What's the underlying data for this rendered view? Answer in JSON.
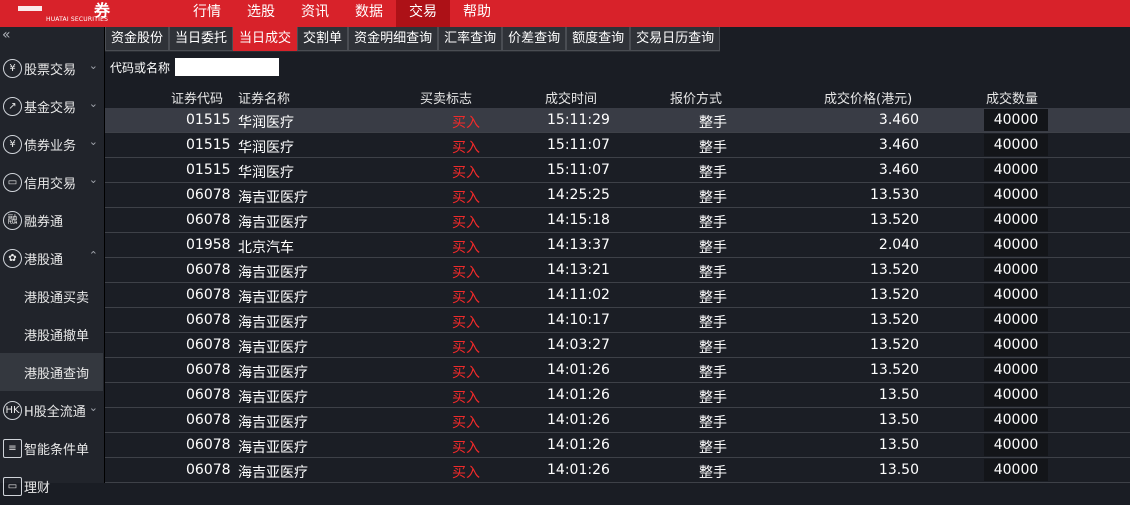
{
  "app": {
    "logo_char": "券",
    "logo_sub": "HUATAI SECURITIES"
  },
  "menu": [
    "行情",
    "选股",
    "资讯",
    "数据",
    "交易",
    "帮助"
  ],
  "menu_active": "交易",
  "sidebar": {
    "collapse_glyph": "«",
    "items": [
      {
        "icon": "¥",
        "label": "股票交易",
        "chev": "⌄"
      },
      {
        "icon": "↗",
        "label": "基金交易",
        "chev": "⌄"
      },
      {
        "icon": "¥",
        "label": "债券业务",
        "chev": "⌄"
      },
      {
        "icon": "▭",
        "label": "信用交易",
        "chev": "⌄"
      },
      {
        "icon": "融",
        "label": "融券通",
        "chev": ""
      },
      {
        "icon": "✿",
        "label": "港股通",
        "chev": "⌃"
      }
    ],
    "sub_items": [
      "港股通买卖",
      "港股通撤单",
      "港股通查询"
    ],
    "active_sub": "港股通查询",
    "bottom_items": [
      {
        "icon": "HK",
        "label": "H股全流通",
        "chev": "⌄"
      },
      {
        "icon": "≡",
        "label": "智能条件单",
        "chev": ""
      },
      {
        "icon": "▭",
        "label": "理财",
        "chev": ""
      }
    ]
  },
  "tabs": [
    "资金股份",
    "当日委托",
    "当日成交",
    "交割单",
    "资金明细查询",
    "汇率查询",
    "价差查询",
    "额度查询",
    "交易日历查询"
  ],
  "active_tab": "当日成交",
  "search": {
    "label": "代码或名称",
    "value": ""
  },
  "columns": [
    "证券代码",
    "证券名称",
    "买卖标志",
    "成交时间",
    "报价方式",
    "成交价格(港元)",
    "成交数量"
  ],
  "rows": [
    {
      "code": "01515",
      "name": "华润医疗",
      "side": "买入",
      "time": "15:11:29",
      "method": "整手",
      "price": "3.460",
      "qty": "40000"
    },
    {
      "code": "01515",
      "name": "华润医疗",
      "side": "买入",
      "time": "15:11:07",
      "method": "整手",
      "price": "3.460",
      "qty": "40000"
    },
    {
      "code": "01515",
      "name": "华润医疗",
      "side": "买入",
      "time": "15:11:07",
      "method": "整手",
      "price": "3.460",
      "qty": "40000"
    },
    {
      "code": "06078",
      "name": "海吉亚医疗",
      "side": "买入",
      "time": "14:25:25",
      "method": "整手",
      "price": "13.530",
      "qty": "40000"
    },
    {
      "code": "06078",
      "name": "海吉亚医疗",
      "side": "买入",
      "time": "14:15:18",
      "method": "整手",
      "price": "13.520",
      "qty": "40000"
    },
    {
      "code": "01958",
      "name": "北京汽车",
      "side": "买入",
      "time": "14:13:37",
      "method": "整手",
      "price": "2.040",
      "qty": "40000"
    },
    {
      "code": "06078",
      "name": "海吉亚医疗",
      "side": "买入",
      "time": "14:13:21",
      "method": "整手",
      "price": "13.520",
      "qty": "40000"
    },
    {
      "code": "06078",
      "name": "海吉亚医疗",
      "side": "买入",
      "time": "14:11:02",
      "method": "整手",
      "price": "13.520",
      "qty": "40000"
    },
    {
      "code": "06078",
      "name": "海吉亚医疗",
      "side": "买入",
      "time": "14:10:17",
      "method": "整手",
      "price": "13.520",
      "qty": "40000"
    },
    {
      "code": "06078",
      "name": "海吉亚医疗",
      "side": "买入",
      "time": "14:03:27",
      "method": "整手",
      "price": "13.520",
      "qty": "40000"
    },
    {
      "code": "06078",
      "name": "海吉亚医疗",
      "side": "买入",
      "time": "14:01:26",
      "method": "整手",
      "price": "13.520",
      "qty": "40000"
    },
    {
      "code": "06078",
      "name": "海吉亚医疗",
      "side": "买入",
      "time": "14:01:26",
      "method": "整手",
      "price": "13.50",
      "qty": "40000"
    },
    {
      "code": "06078",
      "name": "海吉亚医疗",
      "side": "买入",
      "time": "14:01:26",
      "method": "整手",
      "price": "13.50",
      "qty": "40000"
    },
    {
      "code": "06078",
      "name": "海吉亚医疗",
      "side": "买入",
      "time": "14:01:26",
      "method": "整手",
      "price": "13.50",
      "qty": "40000"
    },
    {
      "code": "06078",
      "name": "海吉亚医疗",
      "side": "买入",
      "time": "14:01:26",
      "method": "整手",
      "price": "13.50",
      "qty": "40000"
    }
  ],
  "colors": {
    "brand": "#d8222a",
    "buy": "#f22a2a",
    "bg": "#1a1d24",
    "selected_row": "#393c45"
  }
}
